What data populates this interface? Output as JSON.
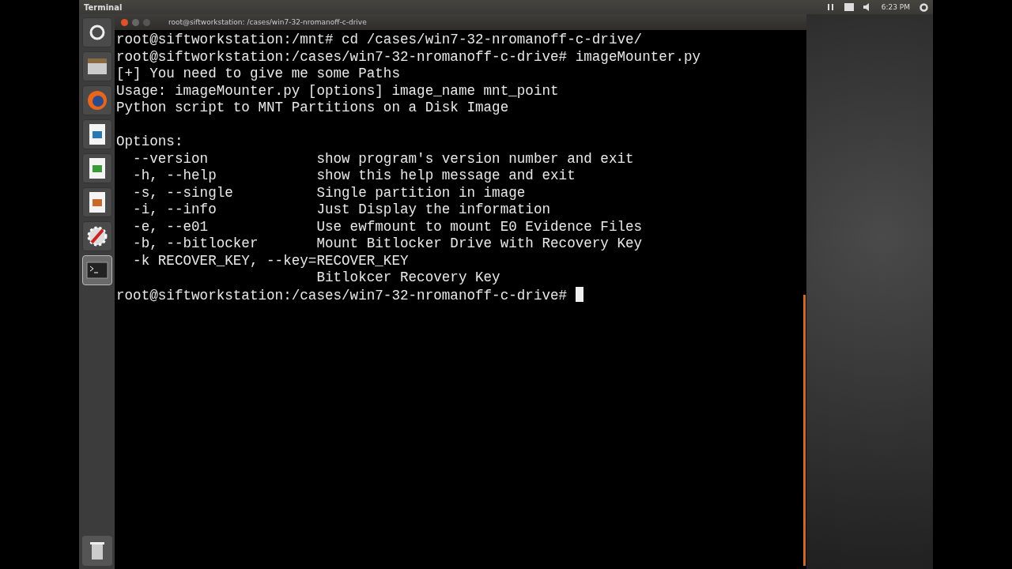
{
  "top_panel": {
    "title": "Terminal",
    "clock": "6:23 PM"
  },
  "launcher": {
    "items": [
      {
        "kind": "dash",
        "selected": false
      },
      {
        "kind": "files",
        "selected": false
      },
      {
        "kind": "browser",
        "selected": false
      },
      {
        "kind": "writer",
        "selected": false
      },
      {
        "kind": "calc",
        "selected": false
      },
      {
        "kind": "impress",
        "selected": false
      },
      {
        "kind": "tools",
        "selected": false
      },
      {
        "kind": "terminal",
        "selected": true
      }
    ]
  },
  "window": {
    "title": "root@siftworkstation: /cases/win7-32-nromanoff-c-drive"
  },
  "terminal": {
    "lines": [
      "root@siftworkstation:/mnt# cd /cases/win7-32-nromanoff-c-drive/",
      "root@siftworkstation:/cases/win7-32-nromanoff-c-drive# imageMounter.py",
      "[+] You need to give me some Paths",
      "Usage: imageMounter.py [options] image_name mnt_point",
      "Python script to MNT Partitions on a Disk Image"
    ],
    "option_lines": [
      "Options:",
      "  --version             show program's version number and exit",
      "  -h, --help            show this help message and exit",
      "  -s, --single          Single partition in image",
      "  -i, --info            Just Display the information",
      "  -e, --e01             Use ewfmount to mount E0 Evidence Files",
      "  -b, --bitlocker       Mount Bitlocker Drive with Recovery Key",
      "  -k RECOVER_KEY, --key=RECOVER_KEY",
      "                        Bitlokcer Recovery Key"
    ],
    "prompt": "root@siftworkstation:/cases/win7-32-nromanoff-c-drive# "
  }
}
